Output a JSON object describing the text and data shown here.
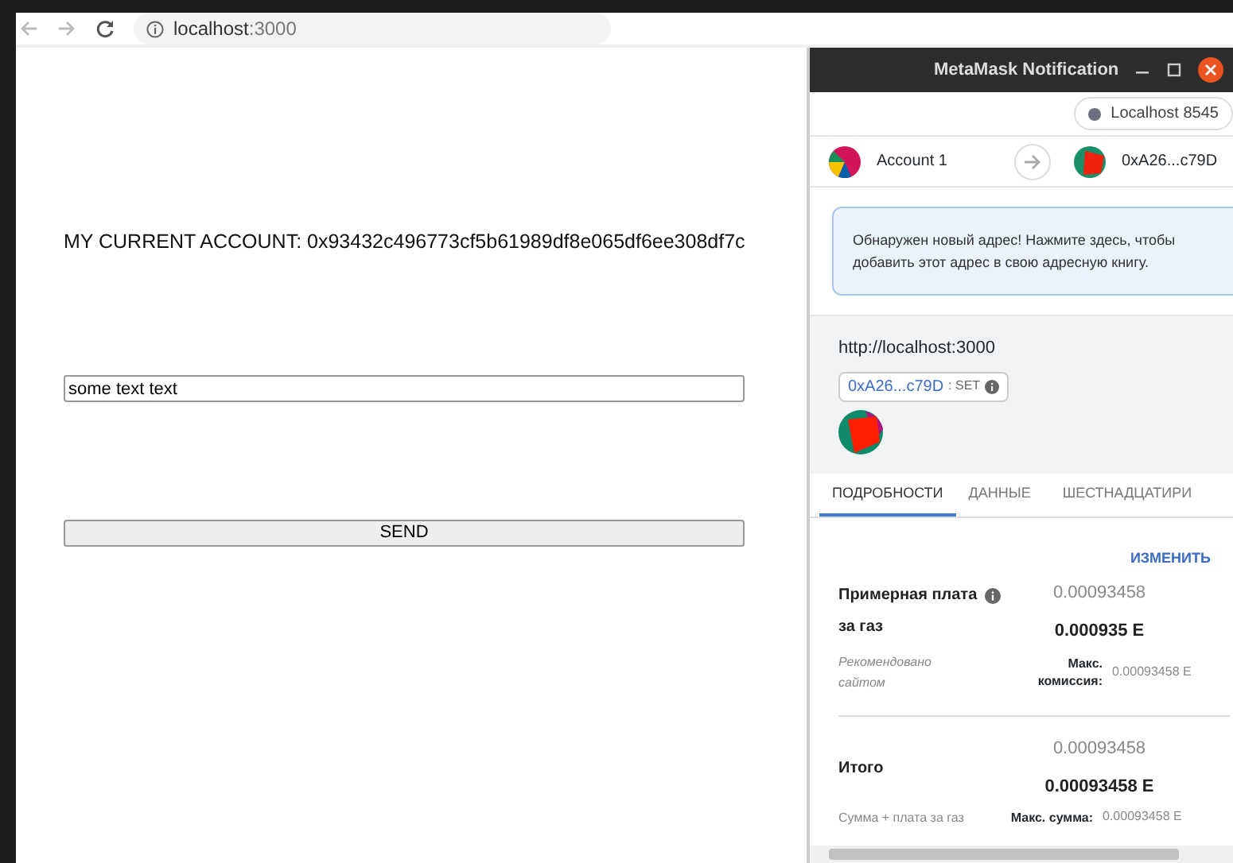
{
  "browser": {
    "url": "**localhost**:3000"
  },
  "page": {
    "account_text": "MY CURRENT ACCOUNT: 0x93432c496773cf5b61989df8e065df6ee308df7c",
    "input_value": "some text text",
    "button": "SEND"
  },
  "metamask": {
    "title": "MetaMask Notification",
    "network": {
      "name": "Localhost 8545",
      "color": "#6a737d"
    },
    "from_account": "Account 1",
    "to_address": "0xA26...c79D",
    "alert": "Обнаружен новый адрес! Нажмите здесь, чтобы добавить этот адрес в свою адресную книгу.",
    "origin": "http://localhost:3000",
    "chip": {
      "address": "0xA26...c79D",
      "tag": ": SET"
    },
    "tabs": [
      {
        "label": "ПОДРОБНОСТИ",
        "selected": true
      },
      {
        "label": "ДАННЫЕ",
        "selected": false
      },
      {
        "label": "ШЕСТНАДЦАТИРИ",
        "selected": false
      }
    ],
    "edit_link": "ИЗМЕНИТЬ",
    "rows": [
      {
        "label": "Примерная плата за газ",
        "info": true,
        "secondary": "0.00093458",
        "primary": "0.000935 E",
        "note": "Рекомендовано сайтом",
        "note_italic": true,
        "max_label": "Макс. комиссия:",
        "max_value": "0.00093458 E"
      },
      {
        "label": "Итого",
        "info": false,
        "secondary": "0.00093458",
        "primary": "0.00093458 E",
        "note": "Сумма + плата за газ",
        "note_italic": false,
        "max_label": "Макс. сумма:",
        "max_value": "0.00093458 E"
      }
    ]
  }
}
